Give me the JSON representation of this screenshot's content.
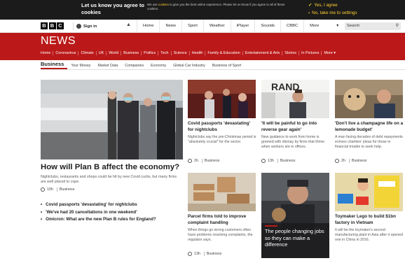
{
  "cookie": {
    "question": "Let us know you agree to cookies",
    "text_before": "We use",
    "text_link": "cookies",
    "text_after": "to give you the best online experience. Please let us know if you agree to all of these cookies.",
    "option_yes": "Yes, I agree",
    "option_settings": "No, take me to settings"
  },
  "global_nav": {
    "logo_letters": [
      "B",
      "B",
      "C"
    ],
    "sign_in": "Sign in",
    "items": [
      "Home",
      "News",
      "Sport",
      "Weather",
      "iPlayer",
      "Sounds",
      "CBBC"
    ],
    "more": "More",
    "search_placeholder": "Search"
  },
  "news_banner": {
    "brand": "NEWS",
    "nav_items": [
      "Home",
      "Coronavirus",
      "Climate",
      "UK",
      "World",
      "Business",
      "Politics",
      "Tech",
      "Science",
      "Health",
      "Family & Education",
      "Entertainment & Arts",
      "Stories",
      "In Pictures",
      "More ▾"
    ]
  },
  "sub_nav": {
    "items": [
      "Business",
      "Your Money",
      "Market Data",
      "Companies",
      "Economy",
      "Global Car Industry",
      "Business of Sport"
    ]
  },
  "lead": {
    "title": "How will Plan B affect the economy?",
    "description": "Nightclubs, restaurants and shops could be hit by new Covid curbs, but many firms are well placed to cope.",
    "time": "10h",
    "tag": "Business",
    "bullets": [
      "Covid passports 'devastating' for nightclubs",
      "'We've had 20 cancellations in one weekend'",
      "Omicron: What are the new Plan B rules for England?"
    ]
  },
  "cards": [
    {
      "title": "Covid passports 'devastating' for nightclubs",
      "description": "Nightclubs say the pre-Christmas period is \"absolutely crucial\" for the sector.",
      "time": "2h",
      "tag": "Business"
    },
    {
      "title": "'It will be painful to go into reverse gear again'",
      "description": "New guidance to work from home is greeted with dismay by firms that thrive when workers are in offices.",
      "time": "13h",
      "tag": "Business",
      "sign_text": "RAND"
    },
    {
      "title": "'Don't live a champagne life on a lemonade budget'",
      "description": "A man facing decades of debt repayments echoes charities' pleas for those in financial trouble to seek help.",
      "time": "2h",
      "tag": "Business"
    },
    {
      "title": "Parcel firms told to improve complaint handling",
      "description": "When things go wrong customers often have problems resolving complaints, the regulator says.",
      "time": "13h",
      "tag": "Business"
    },
    {
      "title": "The people changing jobs so they can make a difference",
      "time": "",
      "tag": ""
    },
    {
      "title": "Toymaker Lego to build $1bn factory in Vietnam",
      "description": "It will be the toymaker's second manufacturing plant in Asia after it opened one in China in 2016.",
      "time": "",
      "tag": ""
    }
  ],
  "colors": {
    "accent": "#bb1919",
    "cookie_bg": "#1b1b1b",
    "cookie_option": "#ffd230"
  }
}
